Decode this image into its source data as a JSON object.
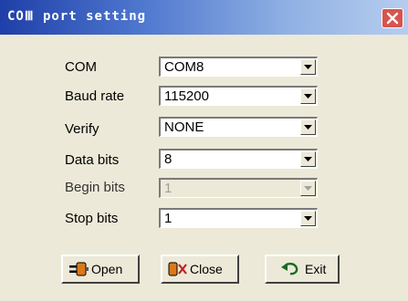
{
  "window": {
    "title": "COⅢ port setting"
  },
  "fields": [
    {
      "label": "COM",
      "value": "COM8",
      "disabled": false
    },
    {
      "label": "Baud rate",
      "value": "115200",
      "disabled": false
    },
    {
      "label": "Verify",
      "value": "NONE",
      "disabled": false
    },
    {
      "label": "Data bits",
      "value": "8",
      "disabled": false
    },
    {
      "label": "Begin bits",
      "value": "1",
      "disabled": true
    },
    {
      "label": "Stop bits",
      "value": "1",
      "disabled": false
    }
  ],
  "buttons": {
    "open": {
      "label": "Open",
      "icon": "plug-connect-icon"
    },
    "close": {
      "label": "Close",
      "icon": "plug-disconnect-icon"
    },
    "exit": {
      "label": "Exit",
      "icon": "undo-arrow-icon"
    }
  },
  "colors": {
    "title_gradient_start": "#1f3fa8",
    "title_gradient_end": "#b7cdef",
    "window_bg": "#ece9d8",
    "close_button": "#d6544f"
  }
}
